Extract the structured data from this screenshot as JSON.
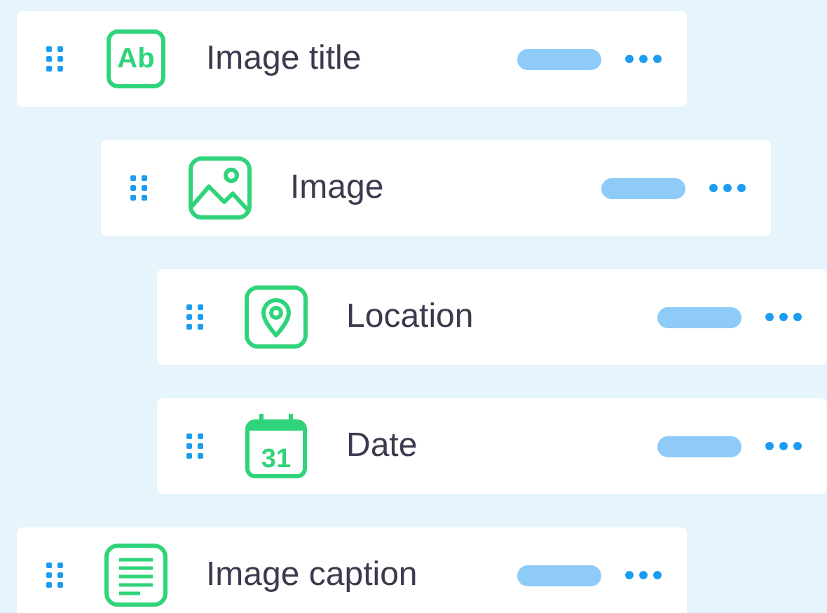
{
  "items": [
    {
      "label": "Image title",
      "kind": "text",
      "icon_text": "Ab",
      "children": [
        {
          "label": "Image",
          "kind": "image",
          "children": [
            {
              "label": "Location",
              "kind": "location"
            },
            {
              "label": "Date",
              "kind": "calendar",
              "icon_text": "31"
            }
          ]
        }
      ]
    },
    {
      "label": "Image caption",
      "kind": "document"
    }
  ]
}
